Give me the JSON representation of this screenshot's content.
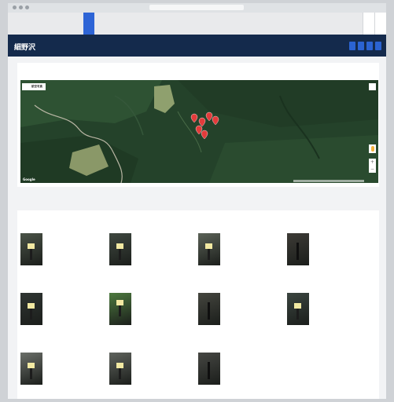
{
  "nav": {
    "items": [
      "",
      "",
      "",
      "",
      "",
      ""
    ],
    "active_index": 3,
    "right": [
      "",
      ""
    ]
  },
  "header": {
    "breadcrumb": "",
    "title": "細野沢",
    "actions": [
      "",
      "",
      "",
      ""
    ]
  },
  "map_section": {
    "label": "",
    "toggle": [
      "",
      "航空写真"
    ],
    "active_toggle": 1,
    "logo": "Google",
    "icons": [
      "fullscreen-icon",
      "pegman-icon",
      "zoom-in-icon",
      "zoom-out-icon",
      "map-pin-icon"
    ]
  },
  "photos_section": {
    "label": "",
    "tiles": [
      {
        "title": "",
        "link": "",
        "variant": "tag",
        "bg": "#4a5347"
      },
      {
        "title": "",
        "link": "",
        "variant": "tag",
        "bg": "#3f4840"
      },
      {
        "title": "",
        "link": "",
        "variant": "tag",
        "bg": "#5b6257"
      },
      {
        "title": "",
        "link": "",
        "variant": "dark",
        "bg": "#3d3b36"
      },
      {
        "title": "",
        "link": "",
        "variant": "tag",
        "bg": "#2f3532"
      },
      {
        "title": "",
        "link": "",
        "variant": "green",
        "bg": "#4d7a3f"
      },
      {
        "title": "",
        "link": "",
        "variant": "dark",
        "bg": "#45463f"
      },
      {
        "title": "",
        "link": "",
        "variant": "tag",
        "bg": "#3b4540"
      },
      {
        "title": "",
        "link": "",
        "variant": "tag",
        "bg": "#6b6f69"
      },
      {
        "title": "",
        "link": "",
        "variant": "tag",
        "bg": "#5f635d"
      },
      {
        "title": "",
        "link": "",
        "variant": "dark",
        "bg": "#464743"
      }
    ]
  },
  "colors": {
    "accent": "#2d64d6",
    "header": "#142a4c",
    "pin": "#e23b3b",
    "satellite": "#25432b"
  }
}
